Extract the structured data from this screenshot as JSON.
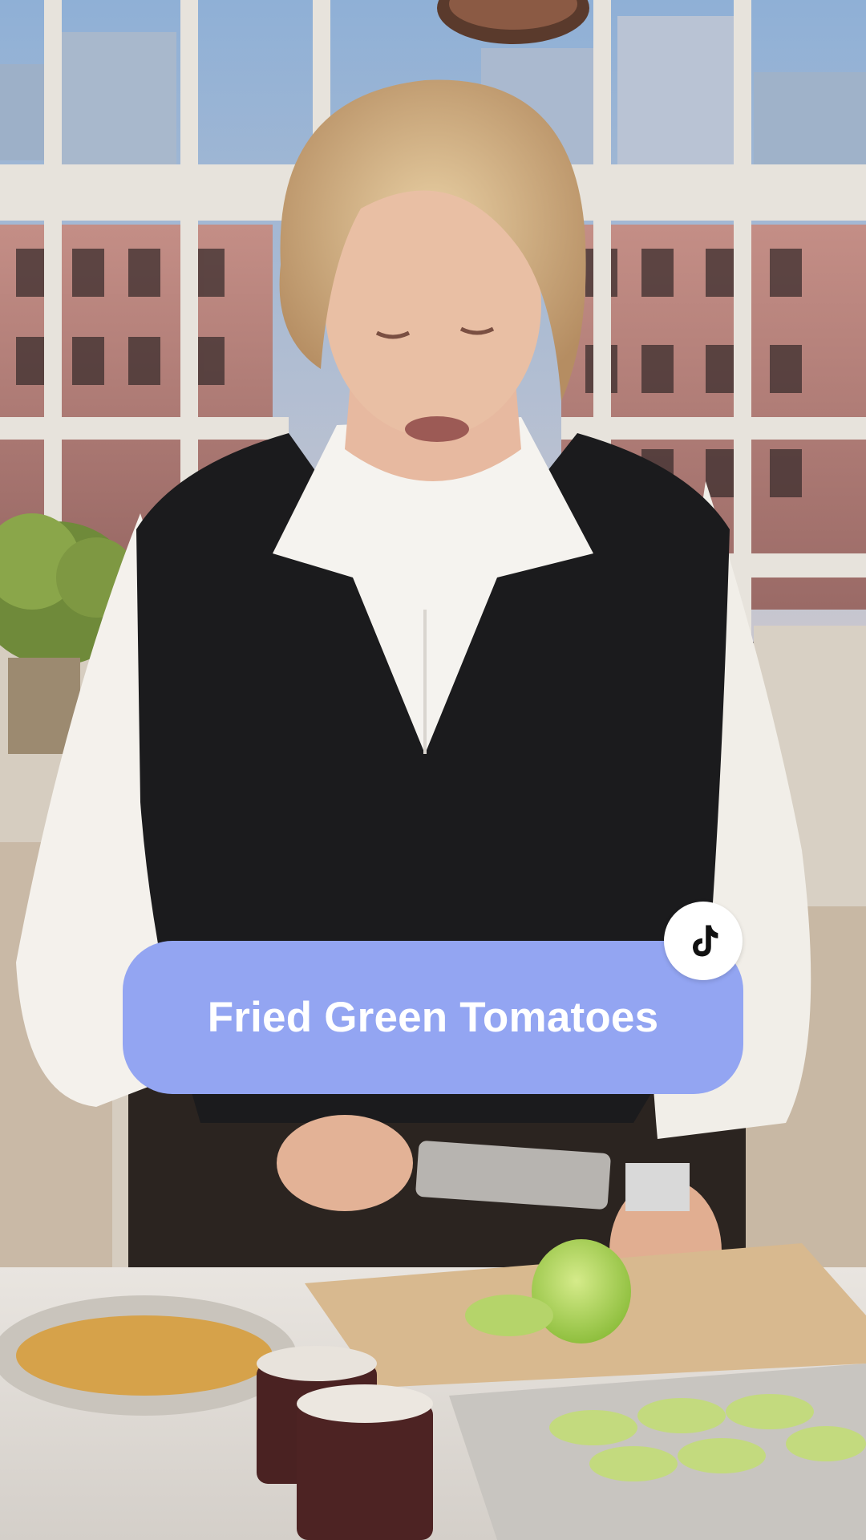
{
  "overlay": {
    "title": "Fried Green Tomatoes"
  },
  "badge": {
    "icon": "tiktok-logo-icon"
  },
  "colors": {
    "pill_background": "#93a5f2",
    "title_text": "#ffffff",
    "badge_background": "#ffffff",
    "badge_icon": "#111111"
  }
}
